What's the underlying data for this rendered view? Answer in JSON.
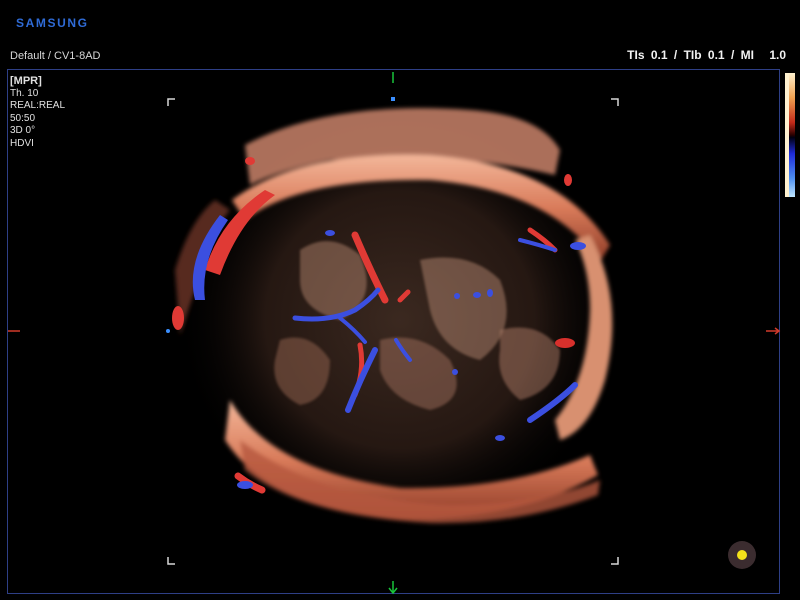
{
  "header": {
    "brand": "SAMSUNG",
    "preset": "Default / CV1-8AD",
    "indices": {
      "tis_label": "TIs",
      "tis_value": "0.1",
      "sep1": "/",
      "tib_label": "TIb",
      "tib_value": "0.1",
      "sep2": "/",
      "mi_label": "MI",
      "mi_value": "1.0"
    }
  },
  "parameters": {
    "mode": "[MPR]",
    "thickness": "Th. 10",
    "render": "REAL:REAL",
    "mix": "50:50",
    "angle": "3D 0°",
    "filter": "HDVI"
  },
  "colors": {
    "brand": "#2f6bd6",
    "frame": "#2e3f86",
    "tissue": "#d9825f",
    "flow_red": "#e03a35",
    "flow_blue": "#3b4fe0",
    "marker_green": "#18c43a",
    "marker_red": "#d23a2a",
    "marker_blue": "#3b8fff",
    "pointer": "#f4e21a"
  },
  "icons": {
    "orientation_marker": "square-marker-icon",
    "pointer": "trackball-pointer-icon"
  }
}
